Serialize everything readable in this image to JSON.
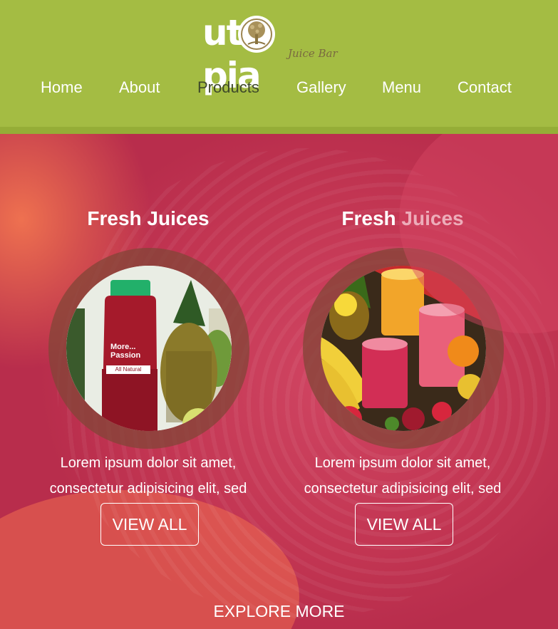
{
  "logo": {
    "text_left": "ut",
    "text_right": "pia",
    "subtitle": "Juice Bar"
  },
  "nav": {
    "items": [
      {
        "label": "Home"
      },
      {
        "label": "About"
      },
      {
        "label": "Products"
      },
      {
        "label": "Gallery"
      },
      {
        "label": "Menu"
      },
      {
        "label": "Contact"
      }
    ],
    "active": "Products"
  },
  "products": [
    {
      "title": "Fresh Juices",
      "description_line1": "Lorem ipsum dolor sit amet,",
      "description_line2": "consectetur adipisicing elit, sed",
      "button_label": "VIEW ALL",
      "bottle_label_line1": "More...",
      "bottle_label_line2": "Passion",
      "bottle_tag": "All Natural"
    },
    {
      "title": "Fresh Juices",
      "description_line1": "Lorem ipsum dolor sit amet,",
      "description_line2": "consectetur adipisicing elit, sed",
      "button_label": "VIEW ALL"
    }
  ],
  "explore_label": "EXPLORE MORE",
  "colors": {
    "header_green": "#a4bc43",
    "header_strip": "#95ad37",
    "active_nav": "#3f4a2a",
    "hero_red": "#c23552",
    "ring": "#82463a"
  },
  "icons": {
    "logo_emblem": "tree-of-life-icon"
  }
}
